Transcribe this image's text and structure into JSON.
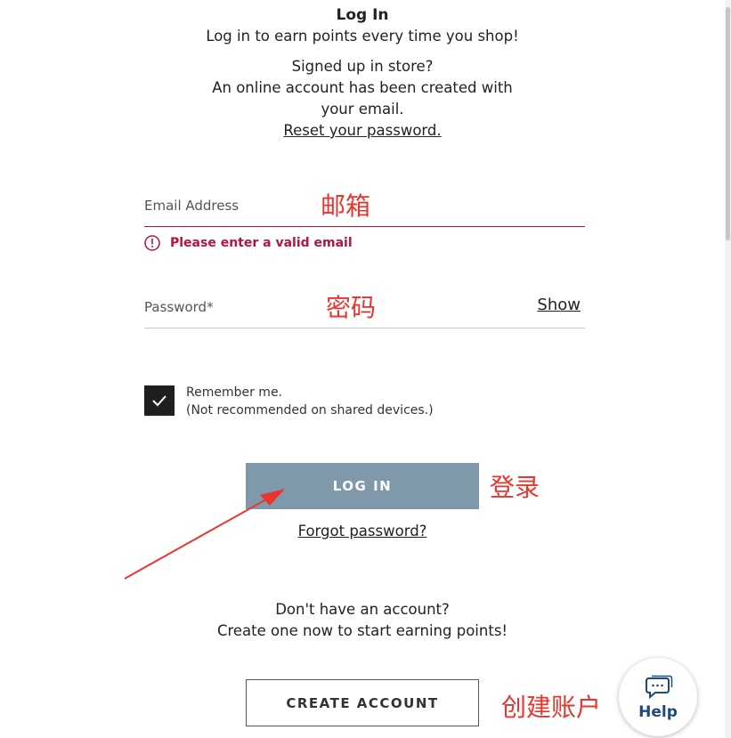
{
  "header": {
    "title": "Log In",
    "subtitle": "Log in to earn points every time you shop!",
    "in_store_line1": "Signed up in store?",
    "in_store_line2": "An online account has been created with",
    "in_store_line3": "your email.",
    "reset_link": "Reset your password."
  },
  "email": {
    "label": "Email Address",
    "annotation": "邮箱",
    "error": "Please enter a valid email"
  },
  "password": {
    "label": "Password*",
    "annotation": "密码",
    "show_label": "Show"
  },
  "remember": {
    "line1": "Remember me.",
    "line2": "(Not recommended on shared devices.)",
    "checked": true
  },
  "login": {
    "button_label": "LOG IN",
    "annotation": "登录",
    "forgot_link": "Forgot password?"
  },
  "signup": {
    "line1": "Don't have an account?",
    "line2": "Create one now to start earning points!",
    "button_label": "CREATE ACCOUNT",
    "annotation": "创建账户"
  },
  "help": {
    "label": "Help"
  },
  "colors": {
    "error": "#b5153d",
    "login_button": "#7f98aa",
    "annotation": "#e8352e",
    "checkbox": "#1f1f1f"
  }
}
